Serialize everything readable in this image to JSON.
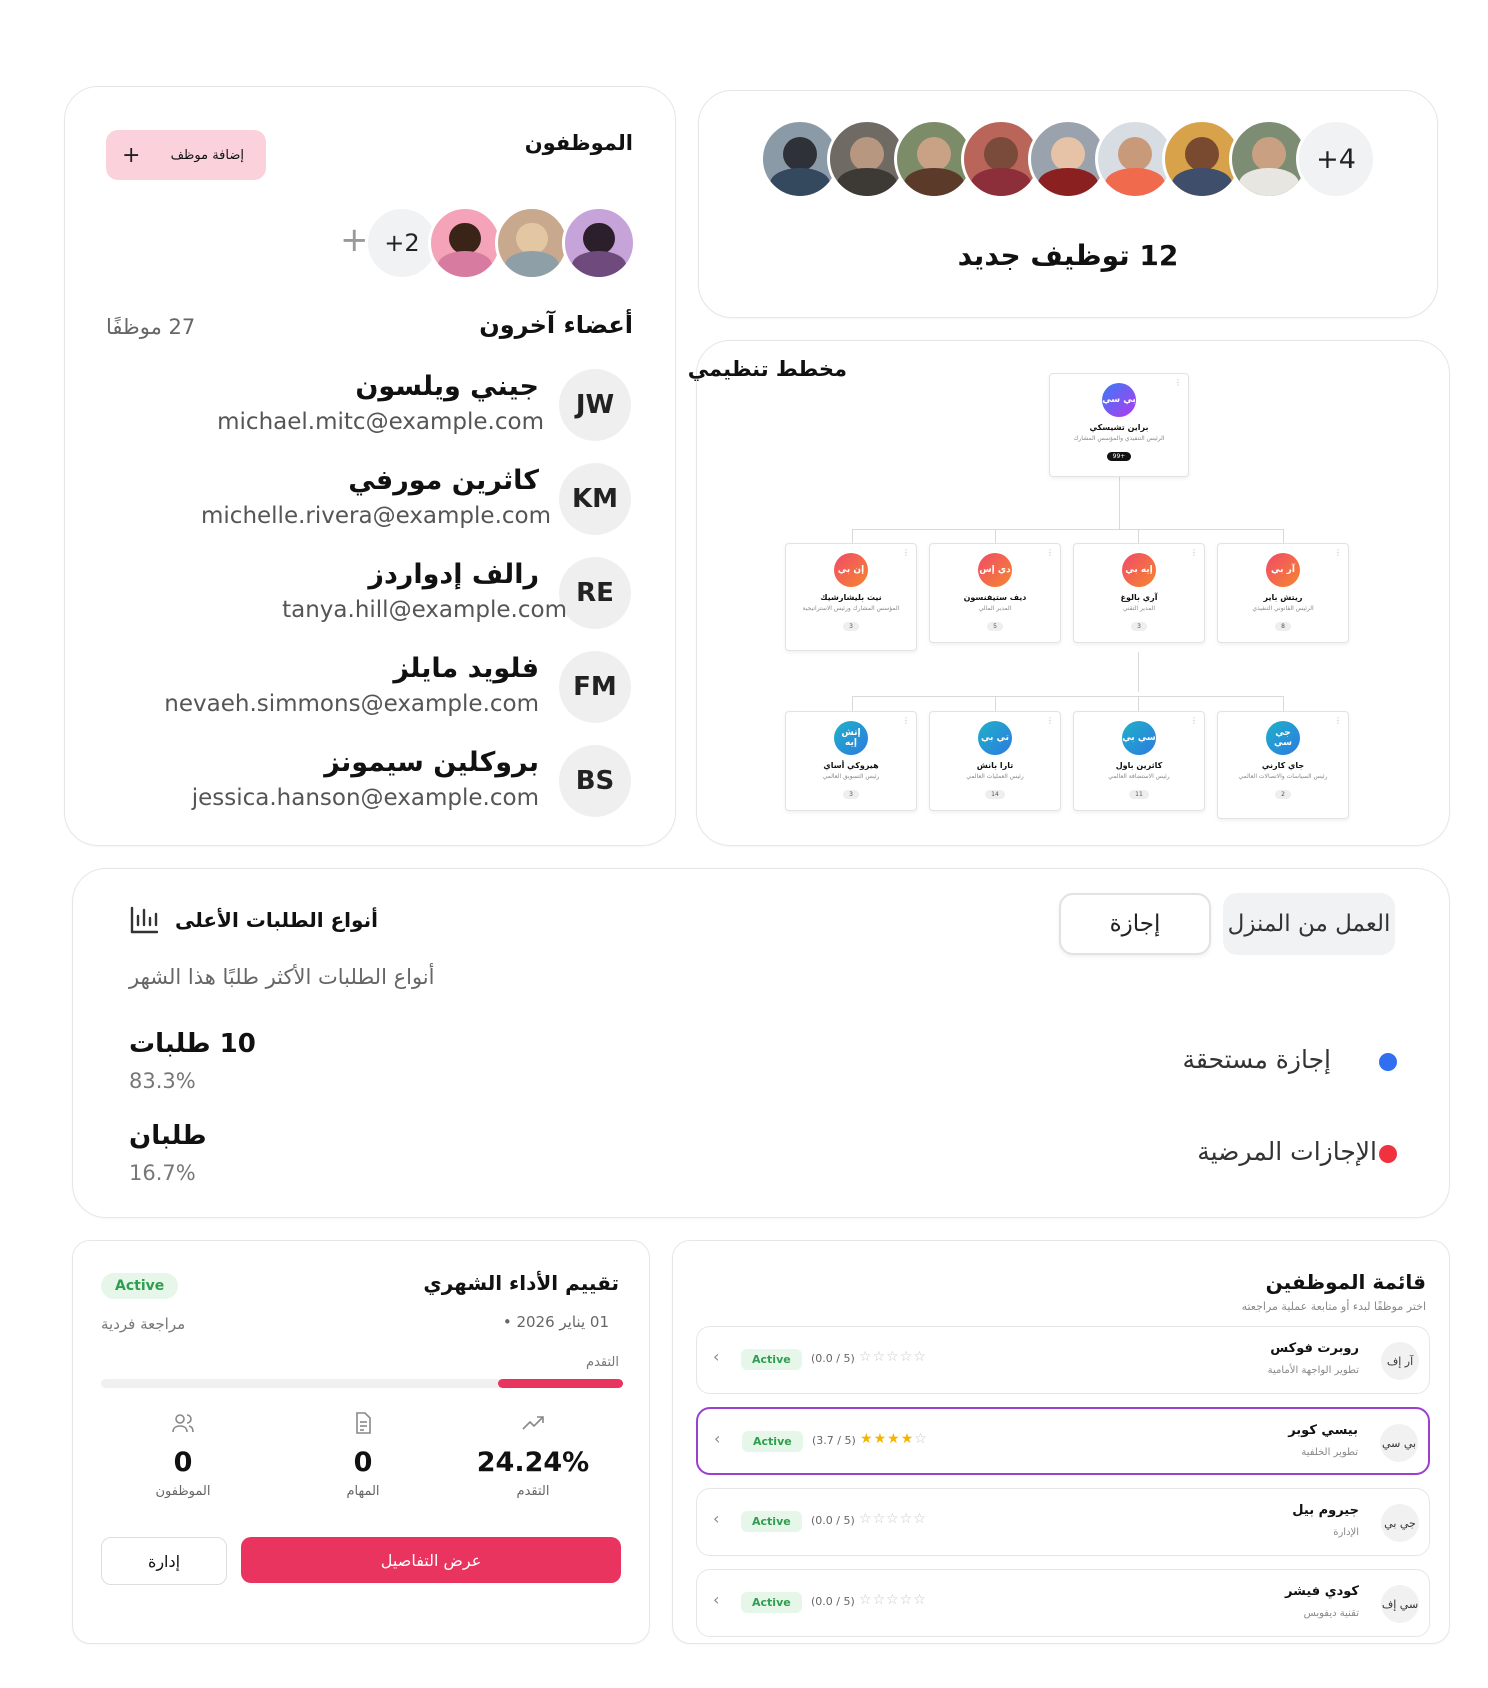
{
  "employees_card": {
    "title": "الموظفون",
    "add_button": "إضافة موظف",
    "add_icon": "plus-icon",
    "avatar_more": "+2",
    "others_title": "أعضاء آخرون",
    "others_count": "27 موظفًا",
    "members": [
      {
        "initials": "JW",
        "name": "جيني ويلسون",
        "email": "michael.mitc@example.com"
      },
      {
        "initials": "KM",
        "name": "كاثرين مورفي",
        "email": "michelle.rivera@example.com"
      },
      {
        "initials": "RE",
        "name": "رالف إدواردز",
        "email": "tanya.hill@example.com"
      },
      {
        "initials": "FM",
        "name": "فلويد مايلز",
        "email": "nevaeh.simmons@example.com"
      },
      {
        "initials": "BS",
        "name": "بروكلين سيمونز",
        "email": "jessica.hanson@example.com"
      }
    ]
  },
  "hires_card": {
    "more": "+4",
    "title": "12 توظيف جديد"
  },
  "org_chart": {
    "title": "مخطط تنظيمي",
    "root": {
      "initials": "بي سي",
      "name": "براين تشيسكي",
      "role": "الرئيس التنفيذي والمؤسس المشارك",
      "badge": "99+"
    },
    "level1": [
      {
        "initials": "إن بي",
        "name": "نيت بليشارشيك",
        "role": "المؤسس المشارك ورئيس الاستراتيجية",
        "badge": "3"
      },
      {
        "initials": "دي إس",
        "name": "ديف ستيفنسون",
        "role": "المدير المالي",
        "badge": "5"
      },
      {
        "initials": "إيه بي",
        "name": "آري بالوغ",
        "role": "المدير التقني",
        "badge": "3"
      },
      {
        "initials": "آر بي",
        "name": "ريتش باير",
        "role": "الرئيس القانوني التنفيذي",
        "badge": "8"
      }
    ],
    "level2": [
      {
        "initials": "إتش إيه",
        "name": "هيروكي أساي",
        "role": "رئيس التسويق العالمي",
        "badge": "3"
      },
      {
        "initials": "تي بي",
        "name": "تارا بانش",
        "role": "رئيس العمليات العالمي",
        "badge": "14"
      },
      {
        "initials": "سي بي",
        "name": "كاثرين باول",
        "role": "رئيس الاستضافة العالمي",
        "badge": "11"
      },
      {
        "initials": "جي سي",
        "name": "جاي كارني",
        "role": "رئيس السياسات والاتصالات العالمي",
        "badge": "2"
      }
    ]
  },
  "requests_card": {
    "title": "أنواع الطلبات الأعلى",
    "chart_icon": "bar-chart-icon",
    "subtitle": "أنواع الطلبات الأكثر طلبًا هذا الشهر",
    "tabs": [
      "العمل من المنزل",
      "إجازة"
    ],
    "items": [
      {
        "label": "إجازة مستحقة",
        "count": "10 طلبات",
        "percent": "83.3%",
        "color": "#2f6ff0"
      },
      {
        "label": "الإجازات المرضية",
        "count": "طلبان",
        "percent": "16.7%",
        "color": "#f0323e"
      }
    ]
  },
  "performance_card": {
    "title": "تقييم الأداء الشهري",
    "status": "Active",
    "date": "01 يناير 2026 •",
    "type": "مراجعة فردية",
    "progress_label": "التقدم",
    "progress": 0.24,
    "stats": [
      {
        "icon": "users-icon",
        "value": "0",
        "label": "الموظفون"
      },
      {
        "icon": "document-icon",
        "value": "0",
        "label": "المهام"
      },
      {
        "icon": "trend-up-icon",
        "value": "24.24%",
        "label": "التقدم"
      }
    ],
    "details_button": "عرض التفاصيل",
    "manage_button": "إدارة"
  },
  "employee_list": {
    "title": "قائمة الموظفين",
    "subtitle": "اختر موظفًا لبدء أو متابعة عملية مراجعته",
    "rows": [
      {
        "initials": "آر إف",
        "name": "روبرت فوكس",
        "role": "تطوير الواجهة الأمامية",
        "status": "Active",
        "score": "(0.0 / 5)",
        "rating": 0
      },
      {
        "initials": "بي سي",
        "name": "بيسي كوبر",
        "role": "تطوير الخلفية",
        "status": "Active",
        "score": "(3.7 / 5)",
        "rating": 3.5
      },
      {
        "initials": "جي بي",
        "name": "جيروم بيل",
        "role": "الإدارة",
        "status": "Active",
        "score": "(0.0 / 5)",
        "rating": 0
      },
      {
        "initials": "سي إف",
        "name": "كودي فيشر",
        "role": "تقنية ديفوبس",
        "status": "Active",
        "score": "(0.0 / 5)",
        "rating": 0
      }
    ]
  }
}
